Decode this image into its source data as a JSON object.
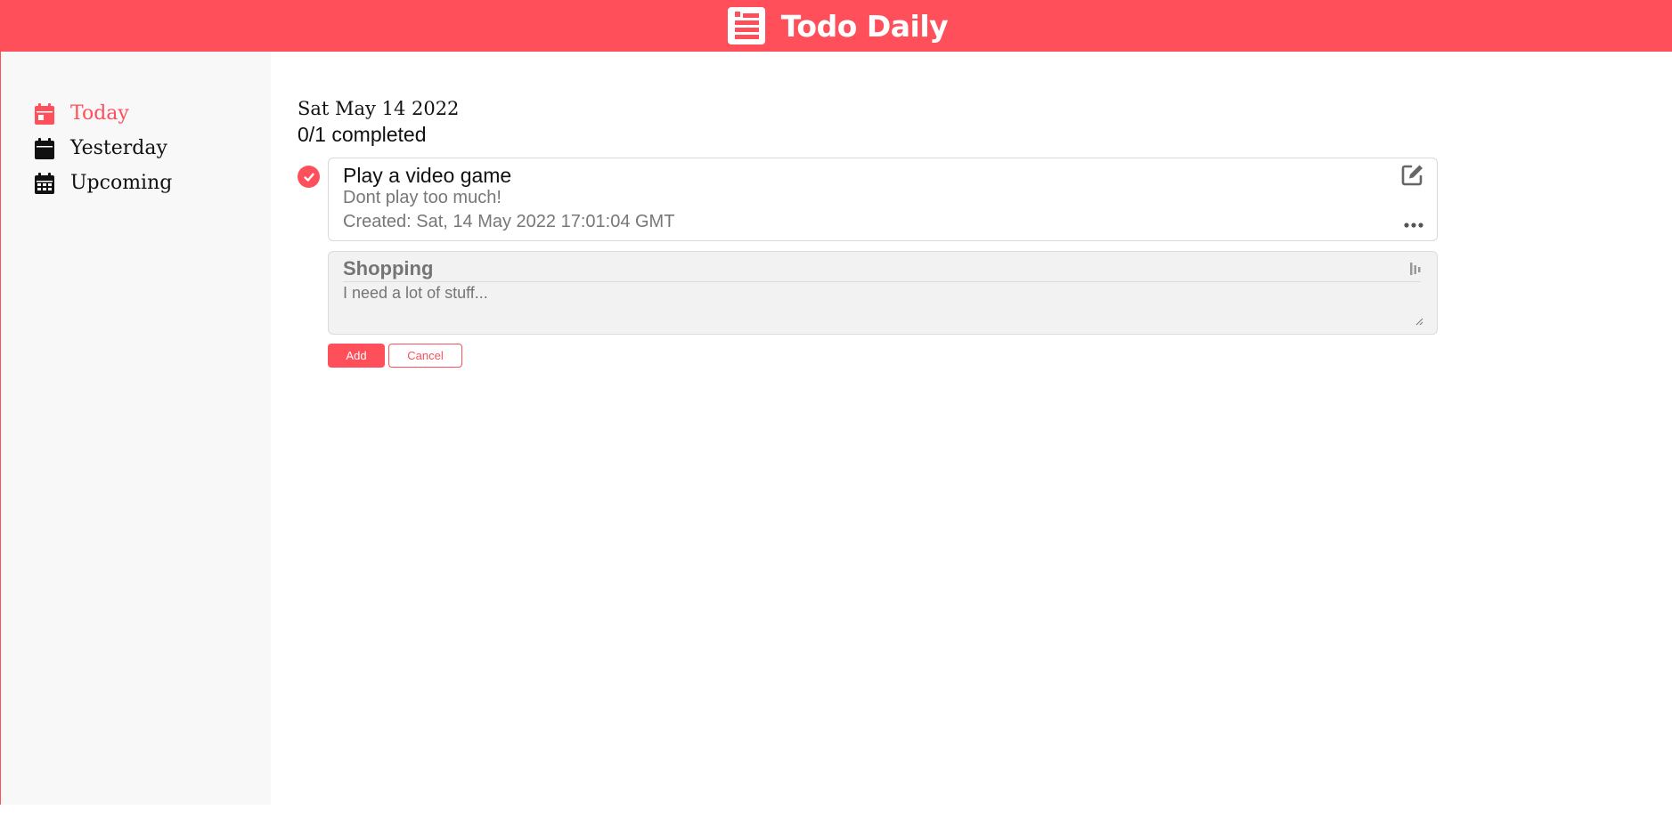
{
  "app": {
    "title": "Todo Daily",
    "icon": "list-icon",
    "brand_color": "#fe4f5b"
  },
  "sidebar": {
    "items": [
      {
        "label": "Today",
        "icon": "calendar-day-icon",
        "active": true
      },
      {
        "label": "Yesterday",
        "icon": "calendar-icon",
        "active": false
      },
      {
        "label": "Upcoming",
        "icon": "calendar-grid-icon",
        "active": false
      }
    ]
  },
  "main": {
    "date": "Sat May 14 2022",
    "progress": "0/1 completed",
    "todos": [
      {
        "title": "Play a video game",
        "description": "Dont play too much!",
        "created": "Created: Sat, 14 May 2022 17:01:04 GMT",
        "completed": false
      }
    ],
    "new_todo": {
      "title_placeholder": "Shopping",
      "description_placeholder": "I need a lot of stuff..."
    },
    "buttons": {
      "add": "Add",
      "cancel": "Cancel"
    }
  }
}
